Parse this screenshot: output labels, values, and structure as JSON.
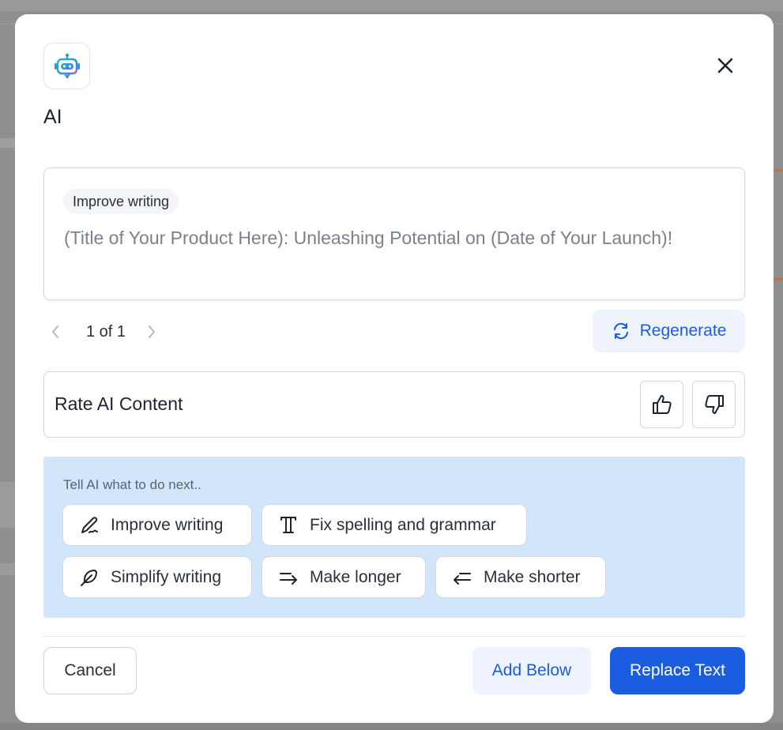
{
  "modal": {
    "title": "AI",
    "app_icon": "robot-icon",
    "close_icon": "close-icon"
  },
  "result": {
    "chip_label": "Improve writing",
    "text": "(Title of Your Product Here): Unleashing Potential on (Date of Your Launch)!"
  },
  "pager": {
    "label": "1 of 1",
    "prev_icon": "chevron-left-icon",
    "next_icon": "chevron-right-icon"
  },
  "regenerate": {
    "label": "Regenerate",
    "icon": "refresh-icon"
  },
  "rating": {
    "label": "Rate AI Content",
    "up_icon": "thumbs-up-icon",
    "down_icon": "thumbs-down-icon"
  },
  "next": {
    "label": "Tell AI what to do next..",
    "actions": [
      {
        "label": "Improve writing",
        "icon": "pen-icon"
      },
      {
        "label": "Fix spelling and grammar",
        "icon": "text-type-icon"
      },
      {
        "label": "Simplify writing",
        "icon": "feather-icon"
      },
      {
        "label": "Make longer",
        "icon": "arrow-right-long-icon"
      },
      {
        "label": "Make shorter",
        "icon": "arrow-left-short-icon"
      }
    ]
  },
  "footer": {
    "cancel_label": "Cancel",
    "add_below_label": "Add Below",
    "replace_label": "Replace Text"
  },
  "colors": {
    "accent": "#1a5de0",
    "accent_soft": "#eef3fd",
    "panel_bg": "#d2e6fb",
    "overlay": "#8f8f8f"
  }
}
